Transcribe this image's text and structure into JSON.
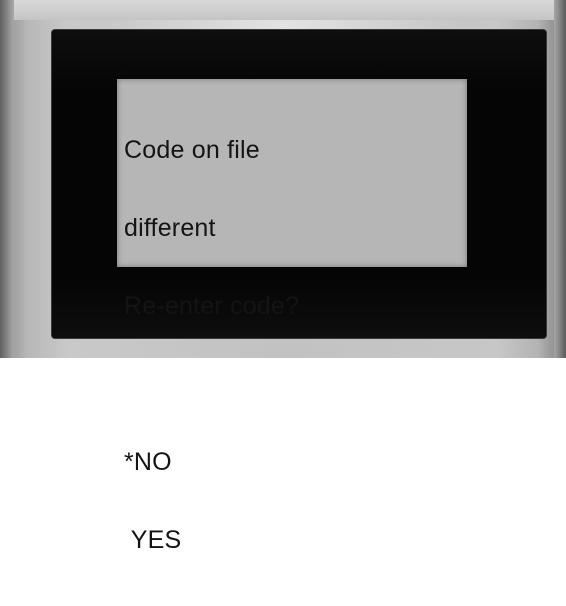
{
  "display": {
    "message_lines": [
      "Code on file",
      "different",
      "Re-enter code?"
    ],
    "options": [
      {
        "label": "*NO",
        "selected": true
      },
      {
        "label": " YES",
        "selected": false
      }
    ]
  }
}
